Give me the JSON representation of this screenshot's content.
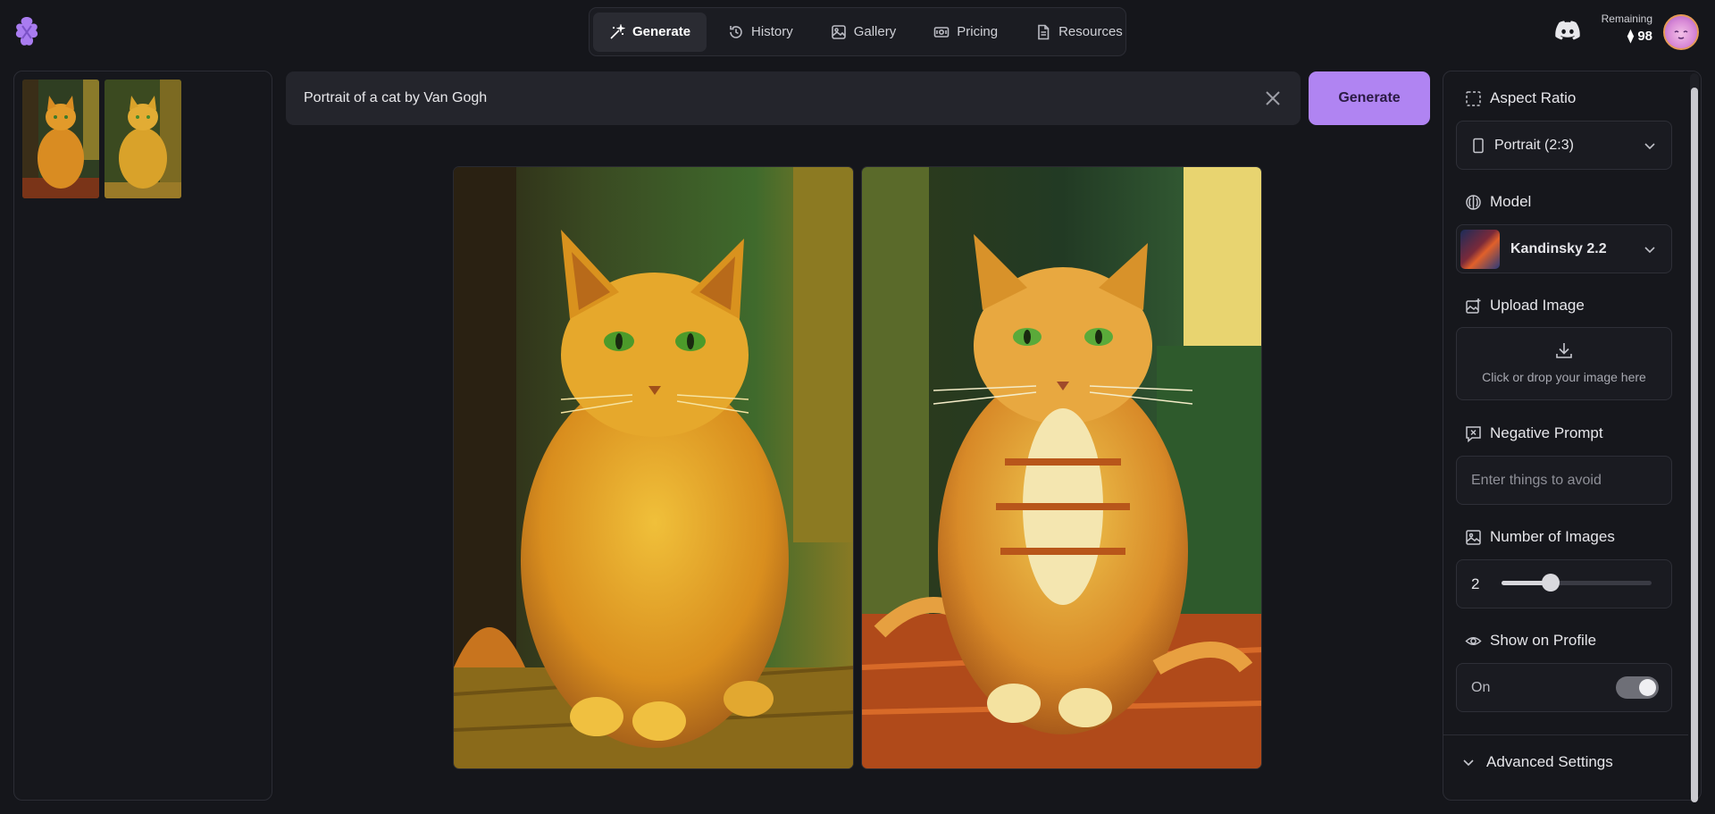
{
  "nav": {
    "tabs": [
      {
        "label": "Generate",
        "icon": "magic-wand-icon",
        "active": true
      },
      {
        "label": "History",
        "icon": "history-icon",
        "active": false
      },
      {
        "label": "Gallery",
        "icon": "gallery-icon",
        "active": false
      },
      {
        "label": "Pricing",
        "icon": "pricing-icon",
        "active": false
      },
      {
        "label": "Resources",
        "icon": "document-icon",
        "active": false
      }
    ]
  },
  "account": {
    "remaining_label": "Remaining",
    "remaining_value": "⧫ 98"
  },
  "prompt": {
    "value": "Portrait of a cat by Van Gogh",
    "generate_label": "Generate"
  },
  "settings": {
    "aspect_ratio": {
      "label": "Aspect Ratio",
      "value": "Portrait (2:3)"
    },
    "model": {
      "label": "Model",
      "value": "Kandinsky 2.2"
    },
    "upload": {
      "label": "Upload Image",
      "hint": "Click or drop your image here"
    },
    "negative_prompt": {
      "label": "Negative Prompt",
      "placeholder": "Enter things to avoid"
    },
    "num_images": {
      "label": "Number of Images",
      "value": "2",
      "slider_fraction": 0.33
    },
    "show_on_profile": {
      "label": "Show on Profile",
      "value": "On",
      "enabled": true
    },
    "advanced": {
      "label": "Advanced Settings"
    }
  },
  "colors": {
    "accent": "#b084f2",
    "background": "#15161b",
    "panel": "#16171c"
  }
}
